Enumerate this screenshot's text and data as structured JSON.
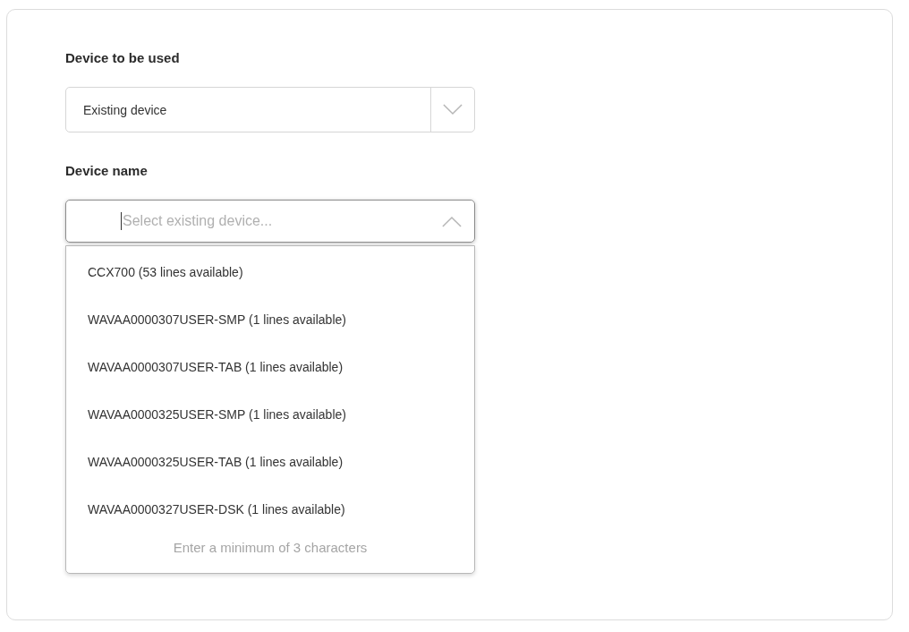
{
  "fields": [
    {
      "kind": "select",
      "label": "Device to be used",
      "value": "Existing device",
      "expanded": false
    },
    {
      "kind": "combobox",
      "label": "Device name",
      "placeholder": "Select existing device...",
      "expanded": true,
      "options": [
        {
          "label": "CCX700 (53 lines available)"
        },
        {
          "label": "WAVAA0000307USER-SMP (1 lines available)"
        },
        {
          "label": "WAVAA0000307USER-TAB (1 lines available)"
        },
        {
          "label": "WAVAA0000325USER-SMP (1 lines available)"
        },
        {
          "label": "WAVAA0000325USER-TAB (1 lines available)"
        },
        {
          "label": "WAVAA0000327USER-DSK (1 lines available)"
        }
      ],
      "hint": "Enter a minimum of 3 characters"
    }
  ]
}
